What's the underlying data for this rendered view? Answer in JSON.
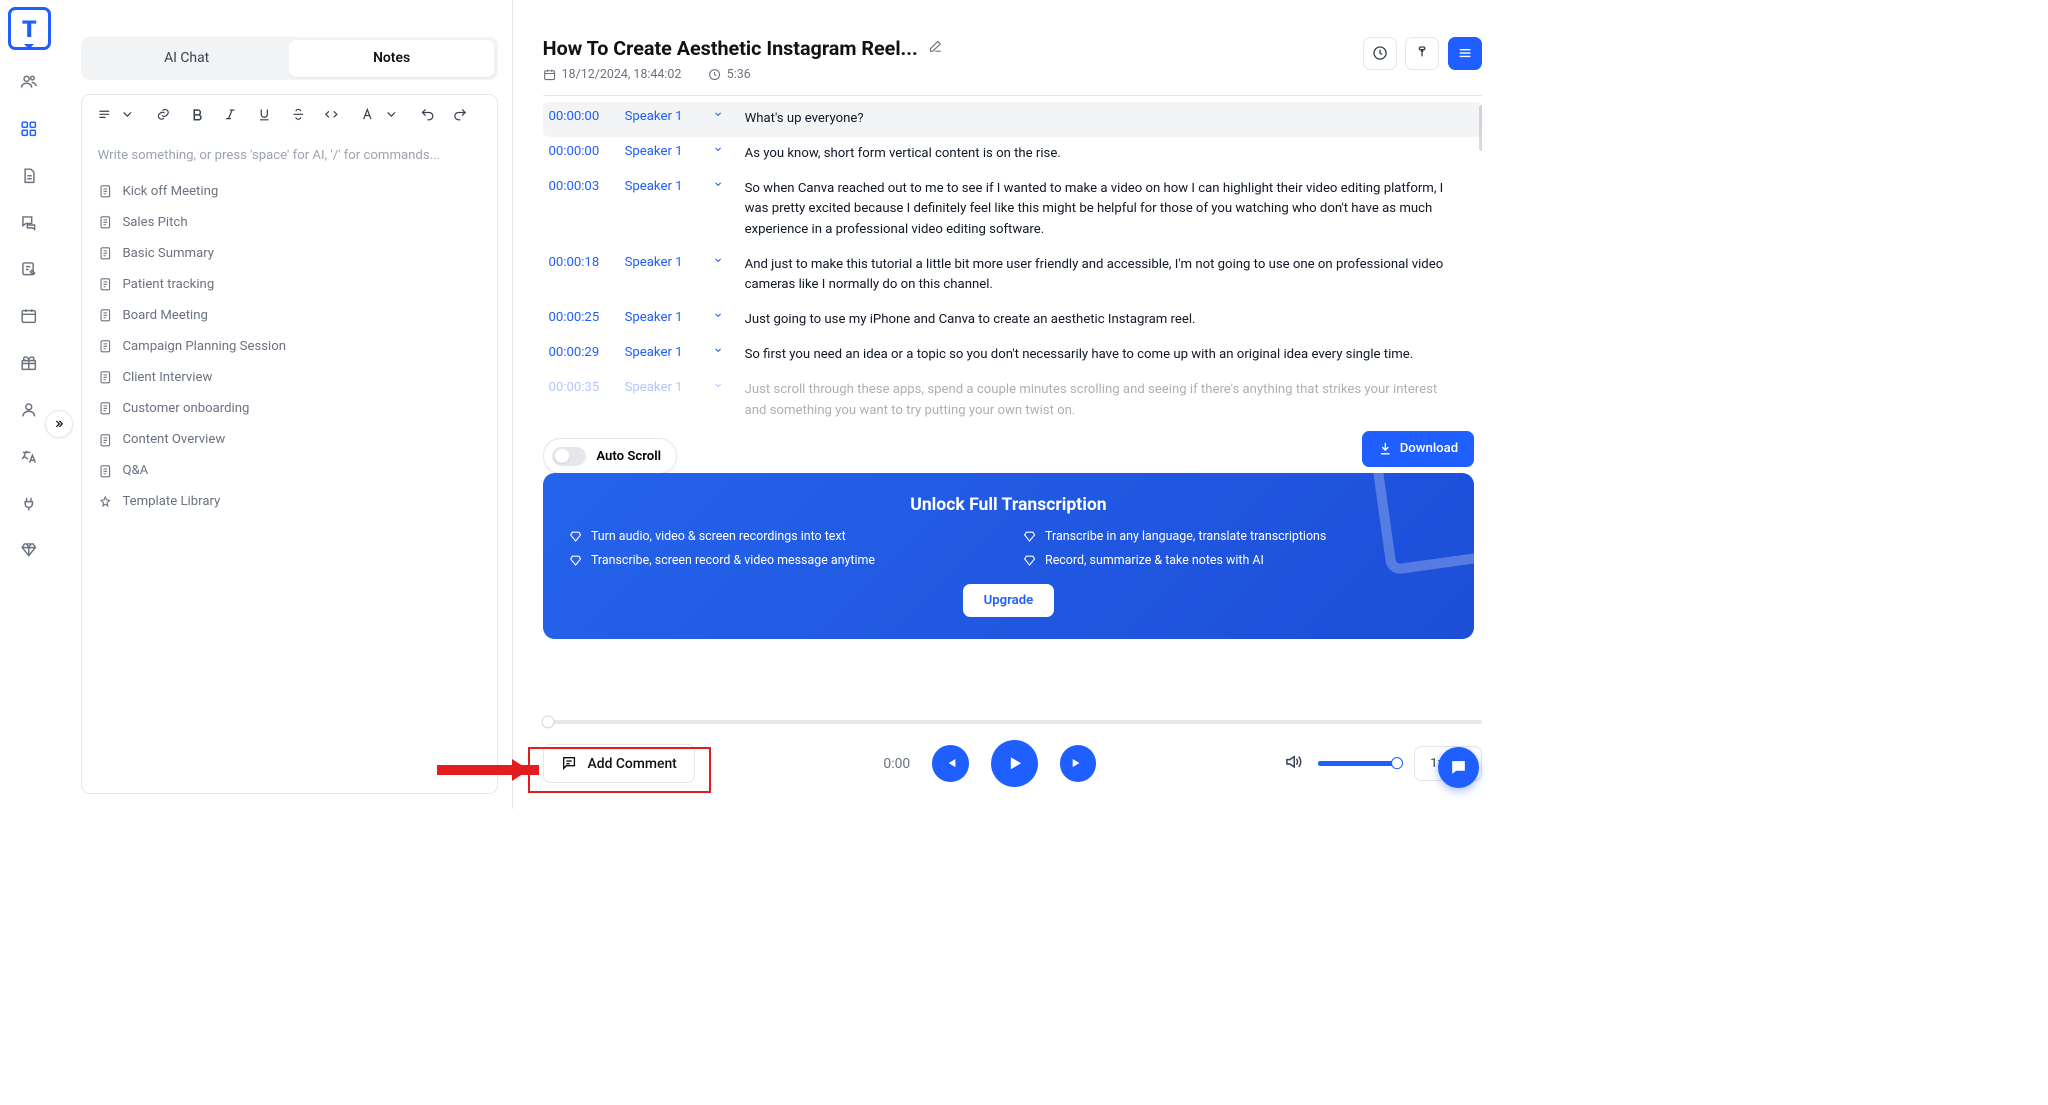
{
  "sidebar": {
    "expand_hint": "»"
  },
  "notes": {
    "tabs": {
      "ai_chat": "AI Chat",
      "notes": "Notes"
    },
    "placeholder": "Write something, or press 'space' for AI, '/' for commands...",
    "templates": [
      "Kick off Meeting",
      "Sales Pitch",
      "Basic Summary",
      "Patient tracking",
      "Board Meeting",
      "Campaign Planning Session",
      "Client Interview",
      "Customer onboarding",
      "Content Overview",
      "Q&A",
      "Template Library"
    ]
  },
  "main": {
    "title": "How To Create Aesthetic Instagram Reel...",
    "date": "18/12/2024, 18:44:02",
    "duration": "5:36",
    "auto_scroll": "Auto Scroll",
    "download": "Download",
    "transcript": [
      {
        "ts": "00:00:00",
        "sp": "Speaker 1",
        "txt": "What's up everyone?"
      },
      {
        "ts": "00:00:00",
        "sp": "Speaker 1",
        "txt": "As you know, short form vertical content is on the rise."
      },
      {
        "ts": "00:00:03",
        "sp": "Speaker 1",
        "txt": "So when Canva reached out to me to see if I wanted to make a video on how I can highlight their video editing platform, I was pretty excited because I definitely feel like this might be helpful for those of you watching who don't have as much experience in a professional video editing software."
      },
      {
        "ts": "00:00:18",
        "sp": "Speaker 1",
        "txt": "And just to make this tutorial a little bit more user friendly and accessible, I'm not going to use one on professional video cameras like I normally do on this channel."
      },
      {
        "ts": "00:00:25",
        "sp": "Speaker 1",
        "txt": "Just going to use my iPhone and Canva to create an aesthetic Instagram reel."
      },
      {
        "ts": "00:00:29",
        "sp": "Speaker 1",
        "txt": "So first you need an idea or a topic so you don't necessarily have to come up with an original idea every single time."
      },
      {
        "ts": "00:00:35",
        "sp": "Speaker 1",
        "txt": "Just scroll through these apps, spend a couple minutes scrolling and seeing if there's anything that strikes your interest and something you want to try putting your own twist on."
      }
    ],
    "unlock": {
      "title": "Unlock Full Transcription",
      "features": [
        "Turn audio, video & screen recordings into text",
        "Transcribe in any language, translate transcriptions",
        "Transcribe, screen record & video message anytime",
        "Record, summarize & take notes with AI"
      ],
      "upgrade": "Upgrade"
    }
  },
  "player": {
    "add_comment": "Add Comment",
    "current": "0:00",
    "speed": "1x"
  }
}
